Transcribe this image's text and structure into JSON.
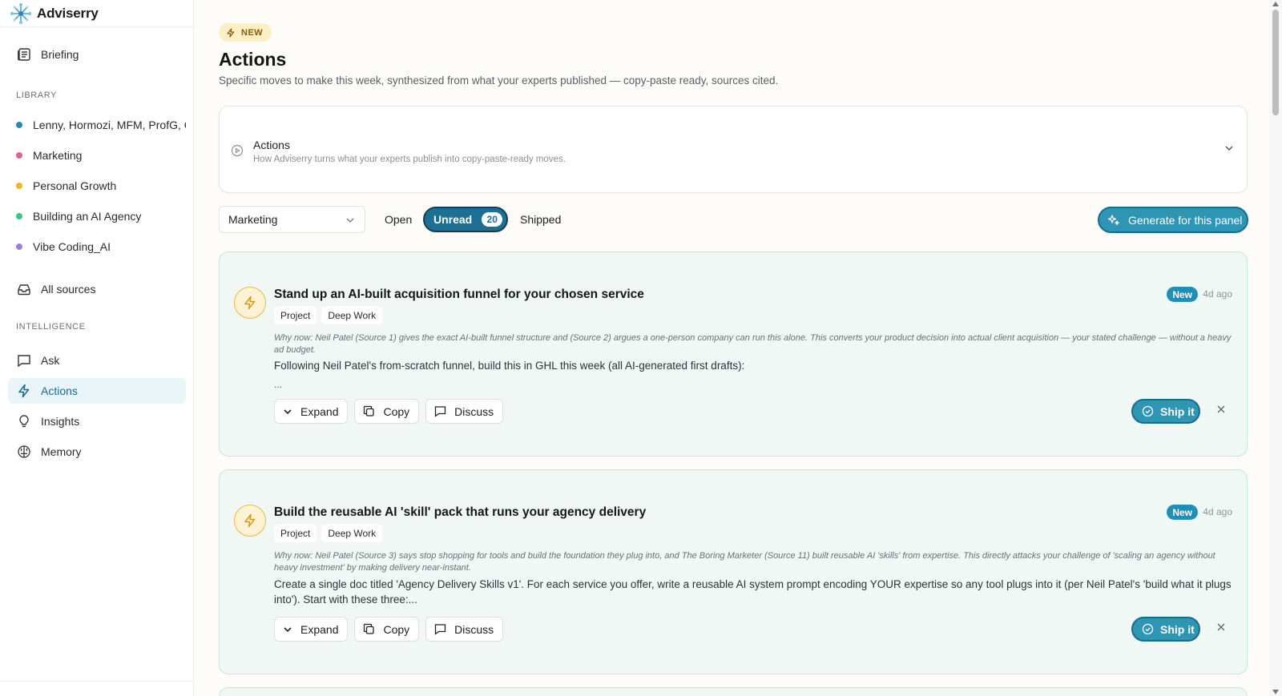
{
  "app": {
    "name": "Adviserry"
  },
  "sidebar": {
    "briefing": "Briefing",
    "library_label": "LIBRARY",
    "library": [
      {
        "label": "Lenny, Hormozi, MFM, ProfG, C",
        "color": "#2a87b0"
      },
      {
        "label": "Marketing",
        "color": "#e0609a"
      },
      {
        "label": "Personal Growth",
        "color": "#f0b323"
      },
      {
        "label": "Building an AI Agency",
        "color": "#3cc488"
      },
      {
        "label": "Vibe Coding_AI",
        "color": "#9b7fe0"
      }
    ],
    "all_sources": "All sources",
    "intelligence_label": "INTELLIGENCE",
    "intelligence": [
      {
        "label": "Ask",
        "icon": "chat-icon"
      },
      {
        "label": "Actions",
        "icon": "bolt-icon"
      },
      {
        "label": "Insights",
        "icon": "lightbulb-icon"
      },
      {
        "label": "Memory",
        "icon": "brain-icon"
      }
    ]
  },
  "header": {
    "badge": "NEW",
    "title": "Actions",
    "subtitle": "Specific moves to make this week, synthesized from what your experts published — copy-paste ready, sources cited."
  },
  "info_card": {
    "title": "Actions",
    "subtitle": "How Adviserry turns what your experts publish into copy-paste-ready moves."
  },
  "filters": {
    "panel_select": "Marketing",
    "tabs": {
      "open": "Open",
      "unread": "Unread",
      "unread_count": "20",
      "shipped": "Shipped"
    },
    "generate_button": "Generate for this panel"
  },
  "actions": [
    {
      "title": "Stand up an AI-built acquisition funnel for your chosen service",
      "tags": [
        "Project",
        "Deep Work"
      ],
      "badge": "New",
      "age": "4d ago",
      "why": "Why now: Neil Patel (Source 1) gives the exact AI-built funnel structure and (Source 2) argues a one-person company can run this alone. This converts your product decision into actual client acquisition — your stated challenge — without a heavy ad budget.",
      "body": "Following Neil Patel's from-scratch funnel, build this in GHL this week (all AI-generated first drafts):",
      "more": "...",
      "buttons": {
        "expand": "Expand",
        "copy": "Copy",
        "discuss": "Discuss",
        "ship": "Ship it"
      }
    },
    {
      "title": "Build the reusable AI 'skill' pack that runs your agency delivery",
      "tags": [
        "Project",
        "Deep Work"
      ],
      "badge": "New",
      "age": "4d ago",
      "why": "Why now: Neil Patel (Source 3) says stop shopping for tools and build the foundation they plug into, and The Boring Marketer (Source 11) built reusable AI 'skills' from expertise. This directly attacks your challenge of 'scaling an agency without heavy investment' by making delivery near-instant.",
      "body": "Create a single doc titled 'Agency Delivery Skills v1'. For each service you offer, write a reusable AI system prompt encoding YOUR expertise so any tool plugs into it (per Neil Patel's 'build what it plugs into'). Start with these three:...",
      "more": "",
      "buttons": {
        "expand": "Expand",
        "copy": "Copy",
        "discuss": "Discuss",
        "ship": "Ship it"
      }
    }
  ]
}
